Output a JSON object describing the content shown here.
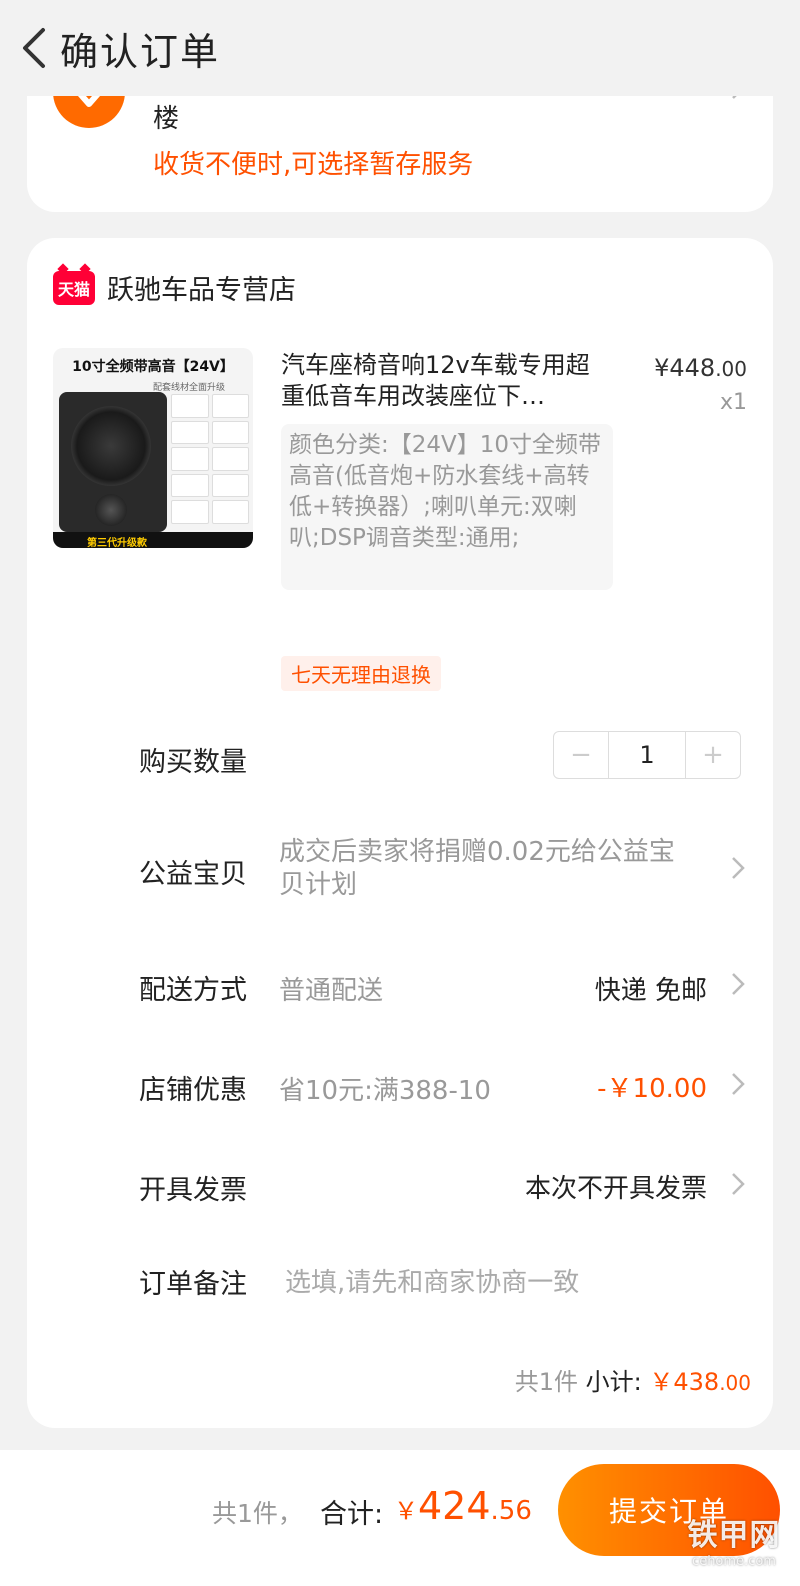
{
  "header": {
    "title": "确认订单"
  },
  "address": {
    "line_partial": "楼",
    "hint": "收货不便时,可选择暂存服务"
  },
  "store": {
    "badge": "天猫",
    "name": "跃驰车品专营店"
  },
  "product": {
    "image_title": "10寸全频带高音【24V】",
    "image_subtitle": "配套线材全面升级",
    "image_badge": "第三代升级款",
    "title": "汽车座椅音响12v车载专用超重低音车用改装座位下…",
    "price_symbol": "¥",
    "price_int": "448",
    "price_dec": ".00",
    "quantity": "x1",
    "sku": "颜色分类:【24V】10寸全频带高音(低音炮+防水套线+高转低+转换器）;喇叭单元:双喇叭;DSP调音类型:通用;",
    "return_tag": "七天无理由退换"
  },
  "rows": {
    "quantity_label": "购买数量",
    "quantity_value": "1",
    "minus": "−",
    "plus": "+",
    "charity_label": "公益宝贝",
    "charity_value": "成交后卖家将捐赠0.02元给公益宝贝计划",
    "delivery_label": "配送方式",
    "delivery_value": "普通配送",
    "delivery_right": "快递 免邮",
    "discount_label": "店铺优惠",
    "discount_value": "省10元:满388-10",
    "discount_amount": "-￥10.00",
    "invoice_label": "开具发票",
    "invoice_right": "本次不开具发票",
    "note_label": "订单备注",
    "note_placeholder": "选填,请先和商家协商一致"
  },
  "subtotal": {
    "count": "共1件",
    "label": "小计:",
    "symbol": "￥",
    "int": "438",
    "dec": ".00"
  },
  "footer": {
    "count": "共1件，",
    "total_label": "合计:",
    "symbol": "￥",
    "int": "424",
    "dec": ".56",
    "submit": "提交订单"
  },
  "watermark": {
    "main": "铁甲网",
    "sub": "cehome.com"
  },
  "colors": {
    "accent": "#ff5000",
    "tmall": "#ff0036",
    "background": "#f2f2f2"
  }
}
